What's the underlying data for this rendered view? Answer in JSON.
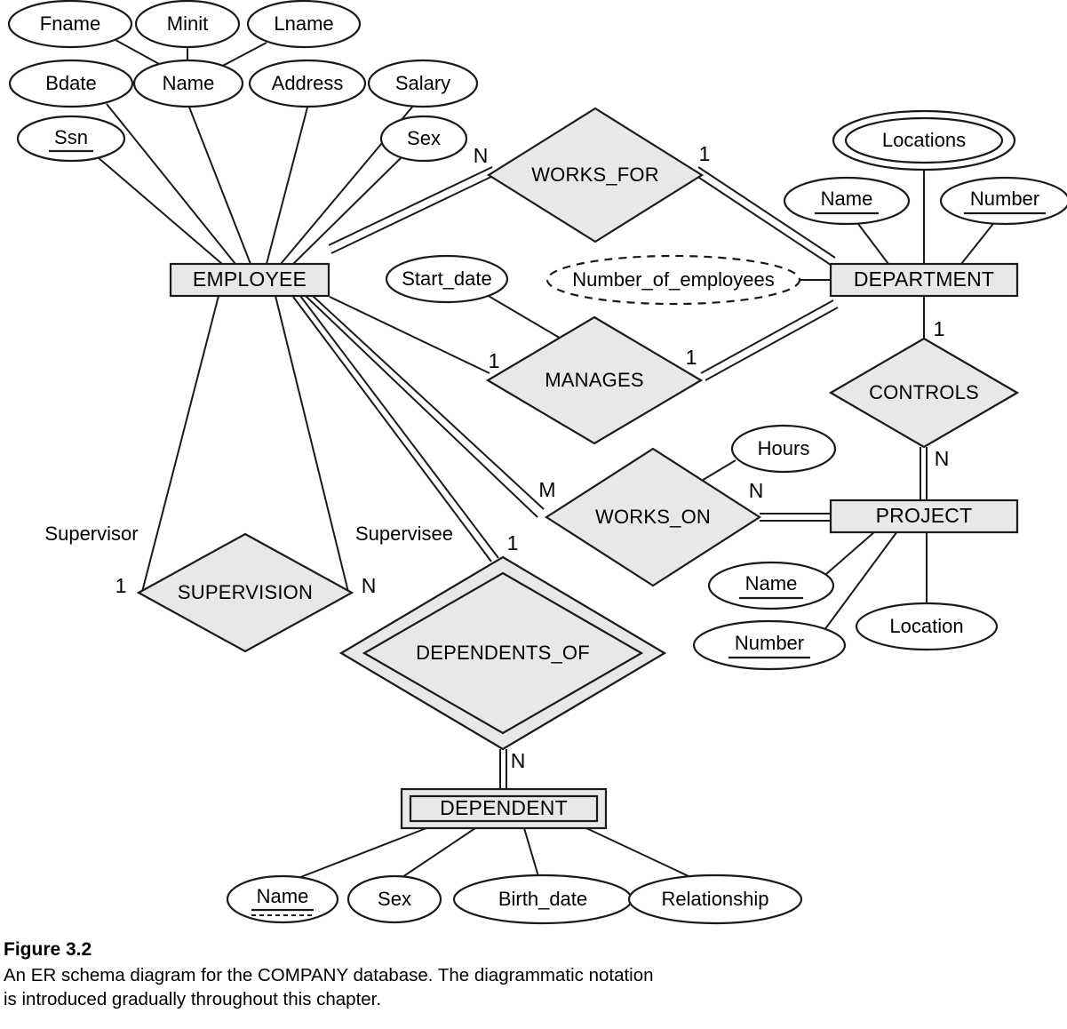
{
  "figure": {
    "title": "Figure 3.2",
    "caption": "An ER schema diagram for the COMPANY database. The diagrammatic notation\nis introduced gradually throughout this chapter."
  },
  "colors": {
    "shape_fill": "#e8e8e8",
    "stroke": "#1a1a1a",
    "background": "#ffffff",
    "ellipse_fill": "#ffffff"
  },
  "entities": [
    {
      "id": "employee",
      "label": "EMPLOYEE",
      "weak": false
    },
    {
      "id": "department",
      "label": "DEPARTMENT",
      "weak": false
    },
    {
      "id": "project",
      "label": "PROJECT",
      "weak": false
    },
    {
      "id": "dependent",
      "label": "DEPENDENT",
      "weak": true
    }
  ],
  "relationships": [
    {
      "id": "works_for",
      "label": "WORKS_FOR",
      "identifying": false
    },
    {
      "id": "manages",
      "label": "MANAGES",
      "identifying": false
    },
    {
      "id": "controls",
      "label": "CONTROLS",
      "identifying": false
    },
    {
      "id": "works_on",
      "label": "WORKS_ON",
      "identifying": false
    },
    {
      "id": "supervision",
      "label": "SUPERVISION",
      "identifying": false
    },
    {
      "id": "dependents_of",
      "label": "DEPENDENTS_OF",
      "identifying": true
    }
  ],
  "attributes": {
    "employee": [
      {
        "id": "fname",
        "label": "Fname",
        "kind": "simple"
      },
      {
        "id": "minit",
        "label": "Minit",
        "kind": "simple"
      },
      {
        "id": "lname",
        "label": "Lname",
        "kind": "simple"
      },
      {
        "id": "name",
        "label": "Name",
        "kind": "composite"
      },
      {
        "id": "bdate",
        "label": "Bdate",
        "kind": "simple"
      },
      {
        "id": "address",
        "label": "Address",
        "kind": "simple"
      },
      {
        "id": "salary",
        "label": "Salary",
        "kind": "simple"
      },
      {
        "id": "ssn",
        "label": "Ssn",
        "kind": "key"
      },
      {
        "id": "sex",
        "label": "Sex",
        "kind": "simple"
      }
    ],
    "department": [
      {
        "id": "dept_locations",
        "label": "Locations",
        "kind": "multivalued"
      },
      {
        "id": "dept_name",
        "label": "Name",
        "kind": "key"
      },
      {
        "id": "dept_number",
        "label": "Number",
        "kind": "key"
      },
      {
        "id": "dept_numemp",
        "label": "Number_of_employees",
        "kind": "derived"
      }
    ],
    "project": [
      {
        "id": "proj_name",
        "label": "Name",
        "kind": "key"
      },
      {
        "id": "proj_number",
        "label": "Number",
        "kind": "key"
      },
      {
        "id": "proj_location",
        "label": "Location",
        "kind": "simple"
      }
    ],
    "dependent": [
      {
        "id": "dep_name",
        "label": "Name",
        "kind": "partial-key"
      },
      {
        "id": "dep_sex",
        "label": "Sex",
        "kind": "simple"
      },
      {
        "id": "dep_birth",
        "label": "Birth_date",
        "kind": "simple"
      },
      {
        "id": "dep_rel",
        "label": "Relationship",
        "kind": "simple"
      }
    ],
    "relationship_attributes": [
      {
        "id": "start_date",
        "label": "Start_date",
        "kind": "simple",
        "owner": "manages"
      },
      {
        "id": "hours",
        "label": "Hours",
        "kind": "simple",
        "owner": "works_on"
      }
    ]
  },
  "cardinalities": {
    "works_for_employee": "N",
    "works_for_department": "1",
    "manages_employee": "1",
    "manages_department": "1",
    "controls_department": "1",
    "controls_project": "N",
    "works_on_employee": "M",
    "works_on_project": "N",
    "supervision_supervisor": "1",
    "supervision_supervisee": "N",
    "dependents_of_employee": "1",
    "dependents_of_dependent": "N"
  },
  "roles": {
    "supervisor": "Supervisor",
    "supervisee": "Supervisee"
  }
}
